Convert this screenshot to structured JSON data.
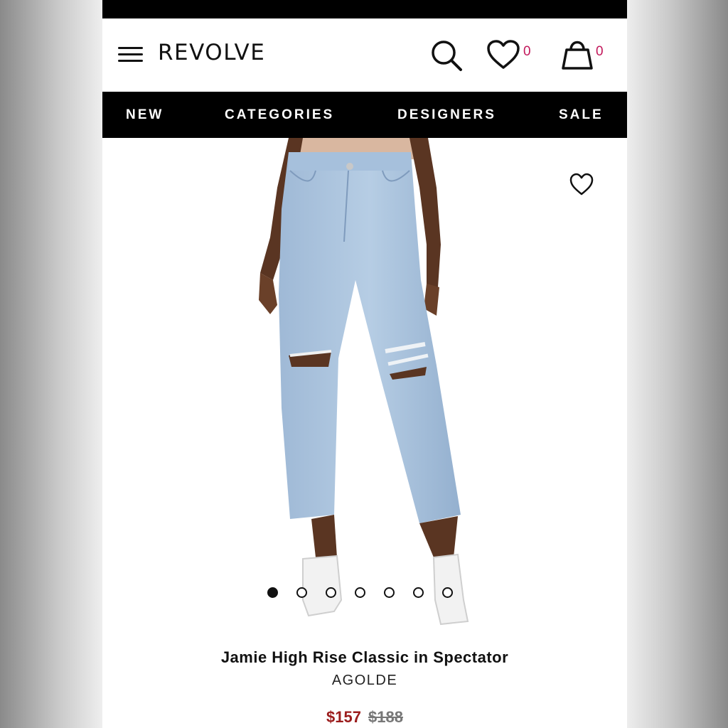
{
  "header": {
    "logo": "REVOLVE",
    "wishlist_count": "0",
    "bag_count": "0"
  },
  "nav": {
    "items": [
      "NEW",
      "CATEGORIES",
      "DESIGNERS",
      "SALE"
    ]
  },
  "product": {
    "title": "Jamie High Rise Classic in Spectator",
    "brand": "AGOLDE",
    "sale_price": "$157",
    "original_price": "$188",
    "image_count": 7,
    "active_image_index": 0
  },
  "colors": {
    "accent": "#c2185b",
    "sale_price": "#9b1c1c",
    "nav_background": "#000000",
    "denim": "#a9c3df"
  },
  "icons": [
    "menu-icon",
    "search-icon",
    "heart-icon",
    "shopping-bag-icon",
    "favorite-heart-icon"
  ]
}
